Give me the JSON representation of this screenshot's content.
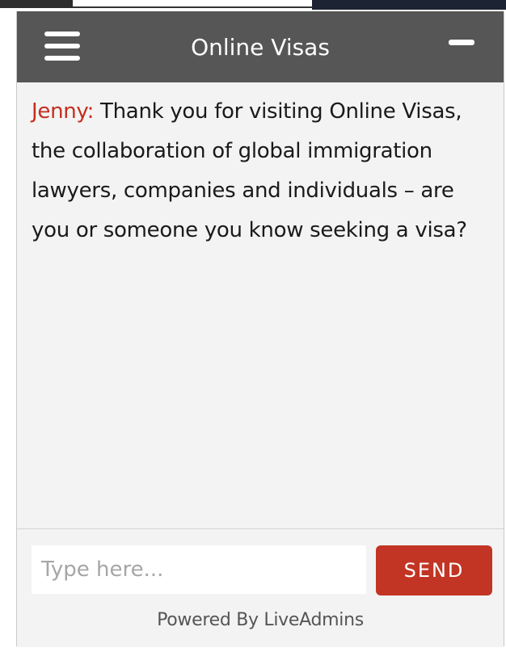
{
  "header": {
    "title": "Online Visas",
    "menu_icon": "hamburger-menu-icon",
    "minimize_icon": "minimize-icon"
  },
  "chat": {
    "messages": [
      {
        "sender": "Jenny:",
        "text": "Thank you for visiting Online Visas, the collaboration of global immigration lawyers, companies and individuals – are you or someone you know seeking a visa?"
      }
    ]
  },
  "composer": {
    "placeholder": "Type here...",
    "value": "",
    "send_label": "SEND"
  },
  "footer": {
    "powered_by": "Powered By LiveAdmins"
  },
  "colors": {
    "header_bg": "#565656",
    "sender_name": "#c62d1f",
    "send_button": "#c23524",
    "panel_bg": "#f3f3f3"
  }
}
